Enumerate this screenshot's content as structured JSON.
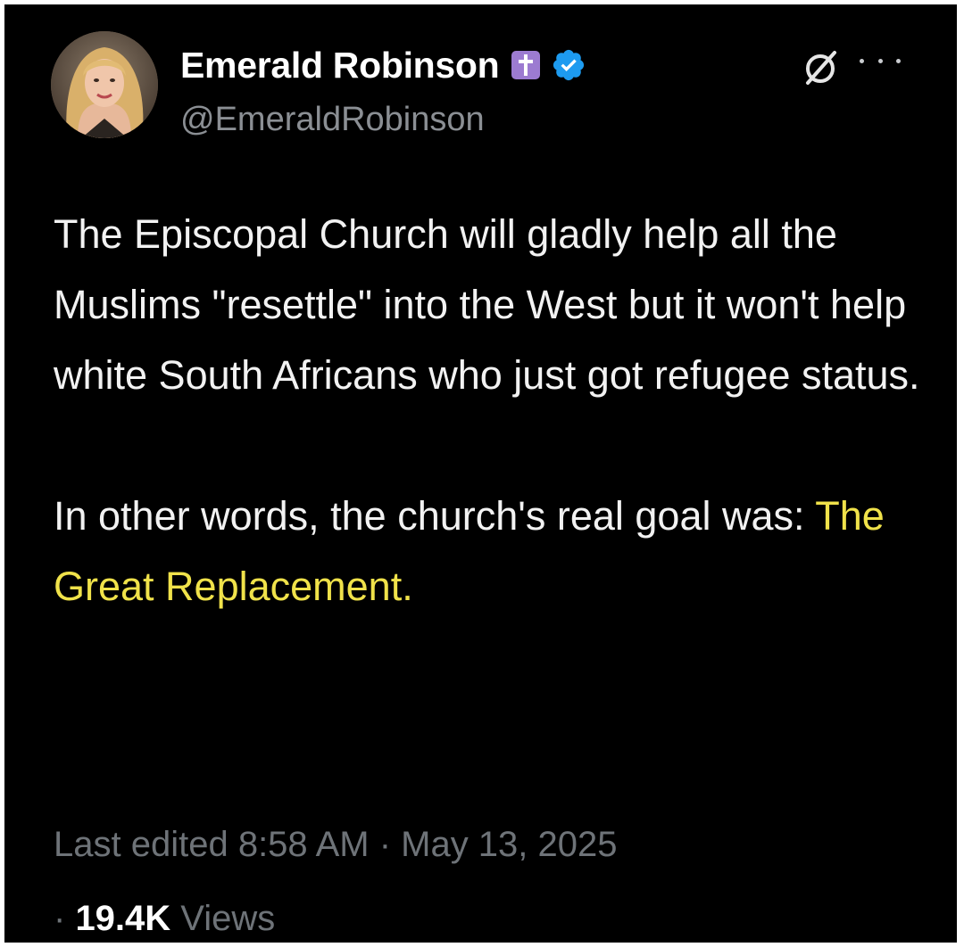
{
  "author": {
    "display_name": "Emerald Robinson",
    "handle": "@EmeraldRobinson"
  },
  "badges": {
    "affiliation_icon": "cross-icon",
    "verified_icon": "verified-check-icon",
    "affiliation_color": "#9c7bd1",
    "verified_color": "#1d9bf0"
  },
  "actions": {
    "grok_icon": "grok-icon",
    "more_icon": "more-options-icon"
  },
  "tweet": {
    "paragraph1": "The Episcopal Church will gladly help all the Muslims \"resettle\" into the West but it won't help white South Africans who just got refugee status.",
    "paragraph2_prefix": "In other words, the church's real goal was: ",
    "paragraph2_highlight": "The Great Replacement.",
    "highlight_color": "#f0e24a"
  },
  "meta": {
    "edited_label": "Last edited 8:58 AM · May 13, 2025",
    "views_prefix": "· ",
    "views_count": "19.4K",
    "views_label": " Views"
  }
}
